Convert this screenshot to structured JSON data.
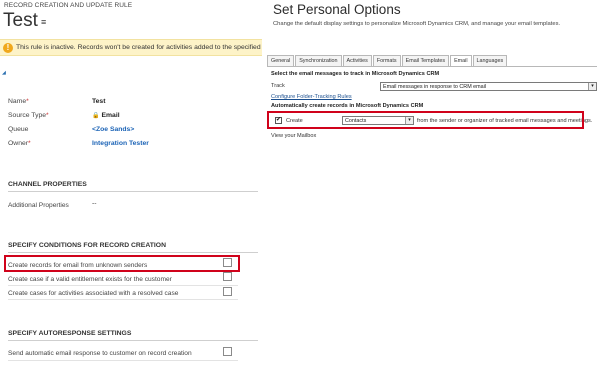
{
  "left": {
    "header": "RECORD CREATION AND UPDATE RULE",
    "title": "Test",
    "title_menu_glyph": "≡",
    "banner_icon": "!",
    "banner_text": "This rule is inactive. Records won't be created for activities added to the specified",
    "fields": {
      "name_label": "Name",
      "name_value": "Test",
      "source_label": "Source Type",
      "source_value": "Email",
      "queue_label": "Queue",
      "queue_value": "<Zoe Sands>",
      "owner_label": "Owner",
      "owner_value": "Integration Tester"
    },
    "required_marker": "*",
    "channel": {
      "title": "CHANNEL PROPERTIES",
      "label": "Additional Properties",
      "value": "--"
    },
    "conditions": {
      "title": "SPECIFY CONDITIONS FOR RECORD CREATION",
      "rows": [
        "Create records for email from unknown senders",
        "Create case if a valid entitlement exists for the customer",
        "Create cases for activities associated with a resolved case"
      ]
    },
    "autoresponse": {
      "title": "SPECIFY AUTORESPONSE SETTINGS",
      "row": "Send automatic email response to customer on record creation"
    }
  },
  "right": {
    "title": "Set Personal Options",
    "subtitle": "Change the default display settings to personalize Microsoft Dynamics CRM, and manage your email templates.",
    "tabs": [
      "General",
      "Synchronization",
      "Activities",
      "Formats",
      "Email Templates",
      "Email",
      "Languages"
    ],
    "active_tab": "Email",
    "track_heading": "Select the email messages to track in Microsoft Dynamics CRM",
    "track_label": "Track",
    "track_value": "Email messages in response to CRM email",
    "folder_link": "Configure Folder-Tracking Rules",
    "auto_heading": "Automatically create records in Microsoft Dynamics CRM",
    "create_label": "Create",
    "create_checked": "✔",
    "create_value": "Contacts",
    "create_suffix": "from the sender or organizer of tracked email messages and meetings.",
    "mailbox_link": "View your Mailbox",
    "dropdown_glyph": "▾"
  },
  "colors": {
    "highlight": "#d0021b",
    "banner_bg": "#fdf3c8",
    "link": "#1b63b6"
  }
}
